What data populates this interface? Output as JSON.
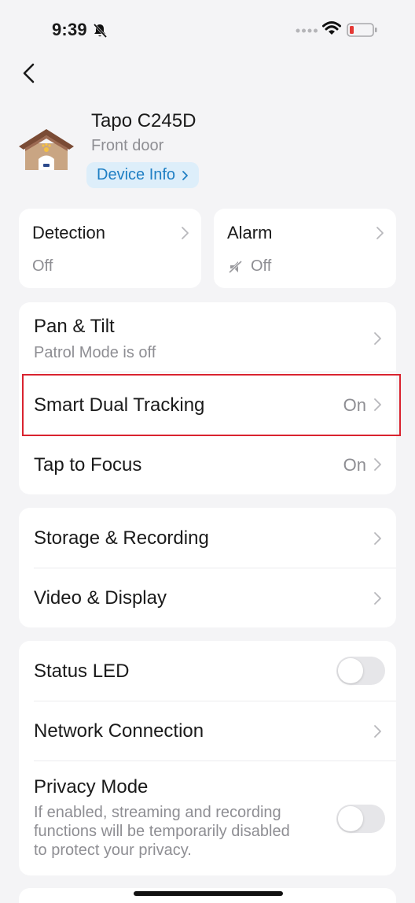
{
  "status_bar": {
    "time": "9:39"
  },
  "device": {
    "name": "Tapo C245D",
    "location": "Front door",
    "info_button": "Device Info"
  },
  "cards": {
    "detection": {
      "title": "Detection",
      "value": "Off"
    },
    "alarm": {
      "title": "Alarm",
      "value": "Off"
    }
  },
  "group1": {
    "pan_tilt": {
      "title": "Pan & Tilt",
      "subtitle": "Patrol Mode is off"
    },
    "smart_dual_tracking": {
      "title": "Smart Dual Tracking",
      "value": "On"
    },
    "tap_to_focus": {
      "title": "Tap to Focus",
      "value": "On"
    }
  },
  "group2": {
    "storage": {
      "title": "Storage & Recording"
    },
    "video": {
      "title": "Video & Display"
    }
  },
  "group3": {
    "status_led": {
      "title": "Status LED"
    },
    "network": {
      "title": "Network Connection"
    },
    "privacy": {
      "title": "Privacy Mode",
      "description_lines": [
        "If enabled, streaming and recording",
        "functions will be temporarily disabled",
        "to protect your privacy."
      ]
    }
  },
  "colors": {
    "background": "#f4f4f6",
    "card": "#ffffff",
    "accent": "#1f7fc4",
    "accent_bg": "#ddeefa",
    "secondary_text": "#8e8e93",
    "highlight": "#d9232f",
    "battery_low": "#e53935"
  },
  "icons": [
    "bell-slash-icon",
    "wifi-icon",
    "battery-icon",
    "back-icon",
    "house-icon",
    "chevron-right-icon",
    "alarm-muted-icon"
  ]
}
